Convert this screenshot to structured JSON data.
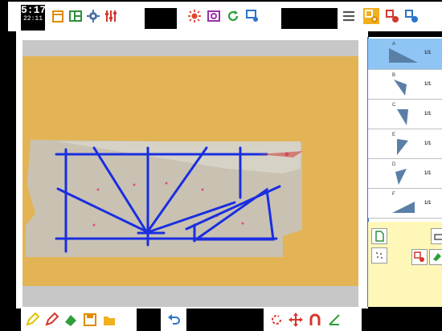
{
  "clock": {
    "top": "5:17",
    "bottom": "22:11"
  },
  "toolbar": {
    "left_icons": [
      "page-icon",
      "layout-icon",
      "gear-icon",
      "sliders-icon"
    ],
    "middle_icons": [
      "brightness-icon",
      "camera-icon",
      "refresh-icon",
      "window-settings-icon"
    ],
    "right_icons": [
      "menu-icon",
      "add-shape-icon",
      "delete-shape-icon",
      "shape-settings-icon"
    ]
  },
  "shape_list": {
    "items": [
      {
        "letter": "A",
        "ratio": "1/1"
      },
      {
        "letter": "B",
        "ratio": "1/1"
      },
      {
        "letter": "C",
        "ratio": "1/1"
      },
      {
        "letter": "E",
        "ratio": "1/1"
      },
      {
        "letter": "D",
        "ratio": "1/1"
      },
      {
        "letter": "F",
        "ratio": "1/1"
      }
    ]
  },
  "bottom_toolbar": {
    "icons": [
      "pencil-icon",
      "eraser-icon",
      "fill-icon",
      "save-icon",
      "folder-icon",
      "undo-icon",
      "rotate-icon",
      "move-icon",
      "magnet-icon",
      "angle-icon"
    ]
  },
  "colors": {
    "board": "#e3b455",
    "accent": "#3a6fd8",
    "line": "#1a2ee0",
    "panel": "#fff7b8"
  }
}
